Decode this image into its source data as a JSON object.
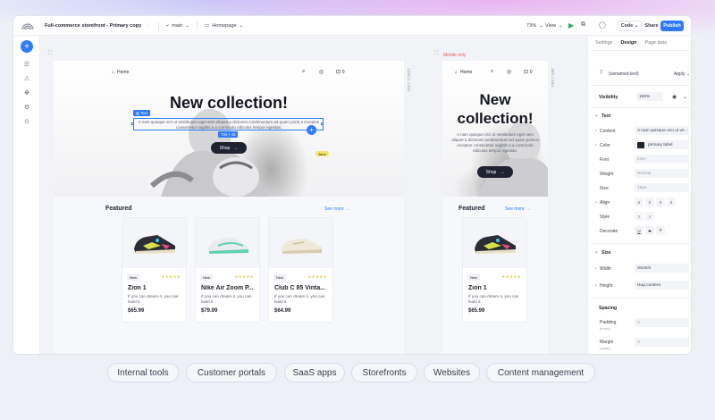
{
  "topbar": {
    "project_title": "Full-commerce storefront - Primary copy",
    "branch": "main",
    "page": "Homepage",
    "zoom": "73%",
    "view": "View",
    "code": "Code",
    "share": "Share",
    "publish": "Publish"
  },
  "canvas": {
    "mobile_label": "Mobile only",
    "main_frame_size": "1280 x 1440",
    "mobile_frame_size": "390 x 844"
  },
  "site": {
    "nav_home": "Home",
    "cart_count": "0",
    "hero_title": "New collection!",
    "hero_title_mobile_1": "New",
    "hero_title_mobile_2": "collection!",
    "hero_sub": "A nam quisque orci ut vestibulum eget sem aliquet a dictumst condimentum ad quam porta a inceptos consectetur sagittis a a commodo ridiculus tempor egestas.",
    "shop": "Shop",
    "selection_tag": "Text",
    "size_tag": "734 × 48",
    "cursor_tag": "Jane",
    "featured": "Featured",
    "see_more": "See more"
  },
  "products": [
    {
      "badge": "New",
      "name": "Zion 1",
      "desc": "If you can dream it, you can build it.",
      "price": "$65.99"
    },
    {
      "badge": "New",
      "name": "Nike Air Zoom P...",
      "desc": "If you can dream it, you can build it.",
      "price": "$79.99"
    },
    {
      "badge": "New",
      "name": "Club C 85 Vinta...",
      "desc": "If you can dream it, you can build it.",
      "price": "$64.99"
    }
  ],
  "panel": {
    "tabs": [
      "Settings",
      "Design",
      "Page data"
    ],
    "element": "(unnamed text)",
    "apply": "Apply",
    "visibility_label": "Visibility",
    "visibility_value": "100%",
    "text_section": "Text",
    "content_label": "Content",
    "content_value": "A nam quisque orci ut ve...",
    "color_label": "Color",
    "color_value": "primary label",
    "font_label": "Font",
    "font_value": "Inter",
    "weight_label": "Weight",
    "weight_value": "Normal",
    "size_label": "Size",
    "size_value": "16px",
    "align_label": "Align",
    "style_label": "Style",
    "decorate_label": "Decorate",
    "size_section": "Size",
    "width_label": "Width",
    "width_value": "Stretch",
    "height_label": "Height",
    "height_value": "Hug content",
    "spacing_section": "Spacing",
    "padding_label": "Padding",
    "padding_sub": "(inner)",
    "padding_value": "0",
    "margin_label": "Margin",
    "margin_sub": "(outer)",
    "margin_value": "0"
  },
  "chips": [
    "Internal tools",
    "Customer portals",
    "SaaS apps",
    "Storefronts",
    "Websites",
    "Content management"
  ],
  "colors": {
    "accent": "#2f7bff",
    "dark": "#1f2230",
    "star": "#e8c94a",
    "run": "#2eaa5c"
  }
}
